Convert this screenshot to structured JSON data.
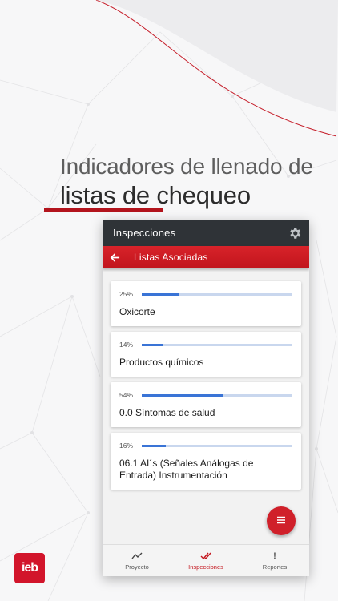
{
  "hero": {
    "line1": "Indicadores de llenado de",
    "line2": "listas de chequeo"
  },
  "appbar": {
    "title": "Inspecciones",
    "icon": "gear-icon"
  },
  "subbar": {
    "title": "Listas Asociadas",
    "icon": "back-arrow-icon"
  },
  "lists": [
    {
      "percent_label": "25%",
      "progress": 0.25,
      "title": "Oxicorte"
    },
    {
      "percent_label": "14%",
      "progress": 0.14,
      "title": "Productos químicos"
    },
    {
      "percent_label": "54%",
      "progress": 0.54,
      "title": "0.0 Síntomas de salud"
    },
    {
      "percent_label": "16%",
      "progress": 0.16,
      "title": "06.1 AI´s (Señales Análogas de Entrada) Instrumentación"
    }
  ],
  "fab": {
    "icon": "menu-icon"
  },
  "bottom_nav": [
    {
      "label": "Proyecto",
      "icon": "trend-icon",
      "active": false
    },
    {
      "label": "Inspecciones",
      "icon": "double-check-icon",
      "active": true
    },
    {
      "label": "Reportes",
      "icon": "exclamation-icon",
      "active": false
    }
  ],
  "logo": {
    "text": "ieb"
  },
  "colors": {
    "brand_red": "#d0202a",
    "appbar_dark": "#2f3337",
    "progress_blue": "#3a74d6",
    "progress_track": "#c9d7ee"
  }
}
